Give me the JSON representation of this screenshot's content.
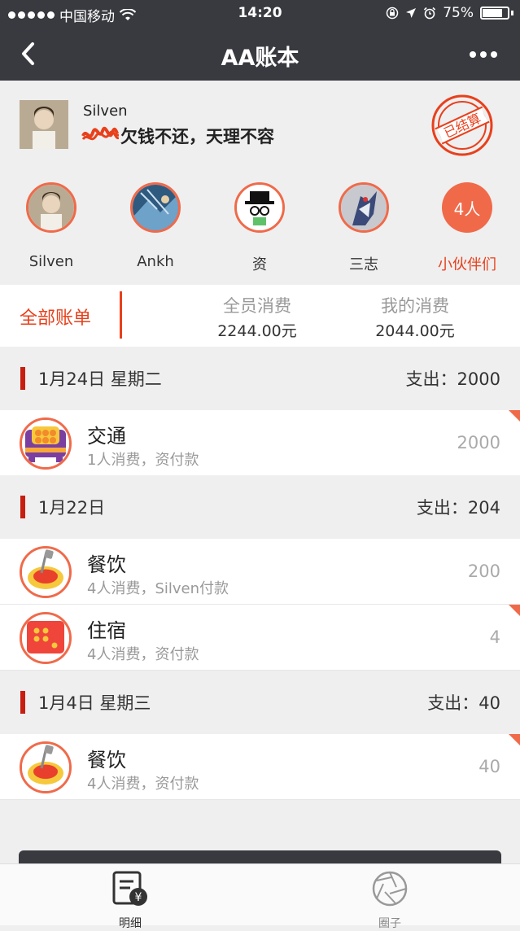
{
  "status_bar": {
    "carrier": "中国移动",
    "time": "14:20",
    "battery": "75%"
  },
  "nav": {
    "title": "AA账本",
    "back_icon": "chevron-left-icon",
    "more_icon": "more-dots-icon"
  },
  "book": {
    "owner_name": "Silven",
    "motto": "欠钱不还，天理不容",
    "stamp_text": "已结算"
  },
  "members": [
    {
      "name": "Silven"
    },
    {
      "name": "Ankh"
    },
    {
      "name": "资"
    },
    {
      "name": "三志"
    }
  ],
  "members_more": {
    "count": "4人",
    "label": "小伙伴们"
  },
  "summary": {
    "all_bills": "全部账单",
    "total_label": "全员消费",
    "total_value": "2244.00元",
    "mine_label": "我的消费",
    "mine_value": "2044.00元"
  },
  "days": [
    {
      "date": "1月24日 星期二",
      "total": "支出：2000",
      "items": [
        {
          "name": "交通",
          "desc": "1人消费，资付款",
          "amount": "2000",
          "icon": "bus-icon",
          "corner": true
        }
      ]
    },
    {
      "date": "1月22日",
      "total": "支出：204",
      "items": [
        {
          "name": "餐饮",
          "desc": "4人消费，Silven付款",
          "amount": "200",
          "icon": "food-icon",
          "corner": false
        },
        {
          "name": "住宿",
          "desc": "4人消费，资付款",
          "amount": "4",
          "icon": "hotel-icon",
          "corner": true
        }
      ]
    },
    {
      "date": "1月4日 星期三",
      "total": "支出：40",
      "items": [
        {
          "name": "餐饮",
          "desc": "4人消费，资付款",
          "amount": "40",
          "icon": "food-icon",
          "corner": true
        }
      ]
    }
  ],
  "tabs": [
    {
      "label": "明细",
      "icon": "bill-yen-icon",
      "active": true
    },
    {
      "label": "圈子",
      "icon": "aperture-icon",
      "active": false
    }
  ],
  "colors": {
    "accent": "#f06a4a",
    "red": "#e8401c",
    "dark": "#393a3f"
  }
}
